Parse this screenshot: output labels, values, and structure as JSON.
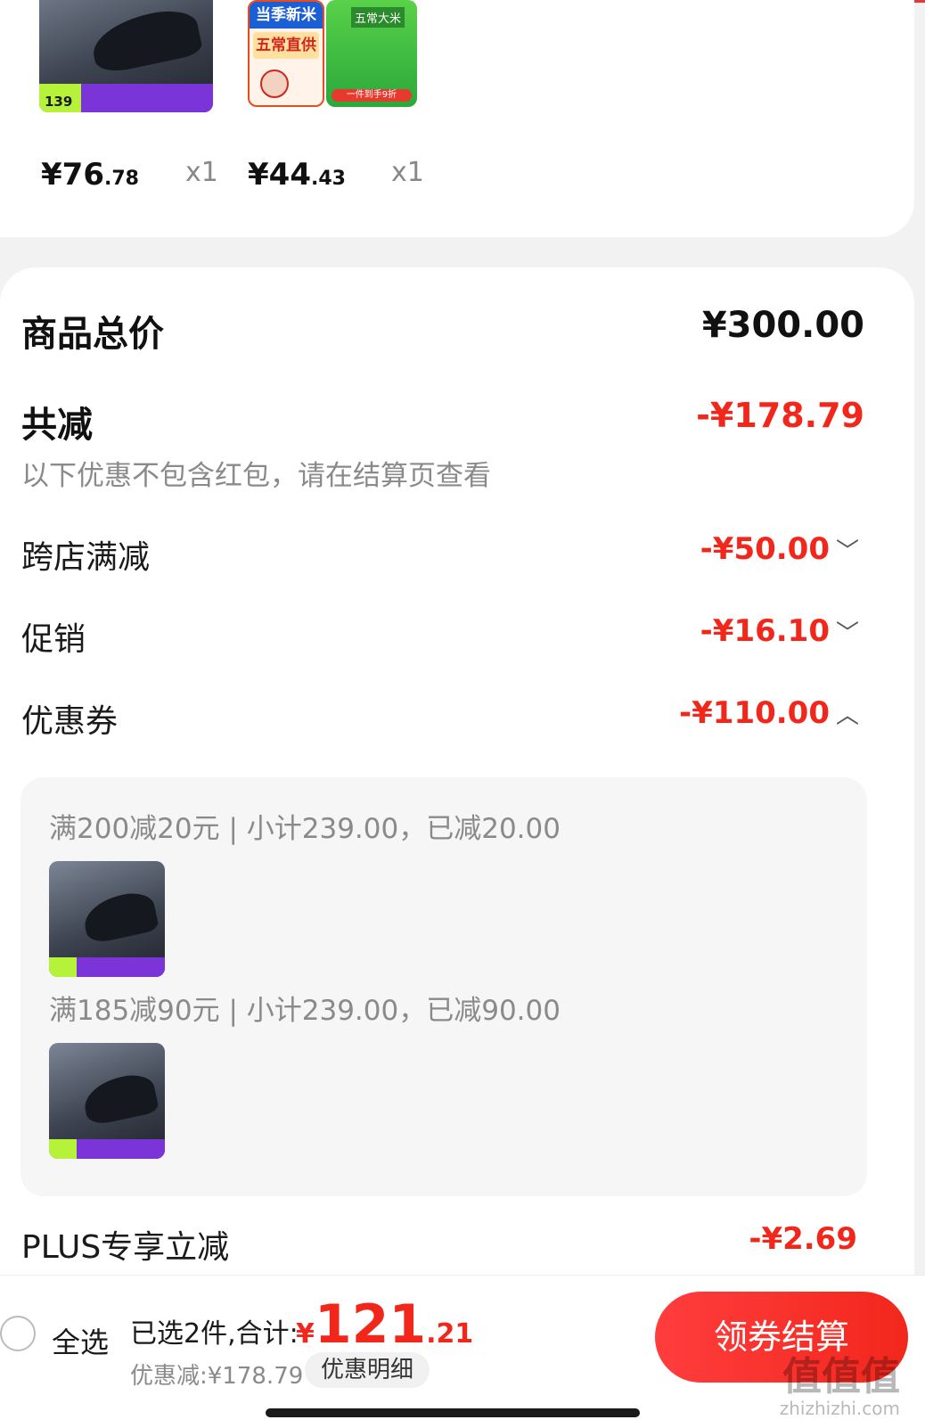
{
  "products": [
    {
      "name": "shoe",
      "price_int": "¥76",
      "price_dec": ".78",
      "qty": "x1"
    },
    {
      "name": "rice",
      "price_int": "¥44",
      "price_dec": ".43",
      "qty": "x1"
    }
  ],
  "rice_tags": {
    "season": "当季新米",
    "direct": "五常直供",
    "brand": "五常大米",
    "promo": "一件到手9折"
  },
  "shoe_tag": {
    "price": "139"
  },
  "summary": {
    "total_label": "商品总价",
    "total_value": "¥300.00",
    "reduce_label": "共减",
    "reduce_value": "-¥178.79",
    "note": "以下优惠不包含红包，请在结算页查看",
    "cross_store_label": "跨店满减",
    "cross_store_value": "-¥50.00",
    "promo_label": "促销",
    "promo_value": "-¥16.10",
    "coupon_label": "优惠券",
    "coupon_value": "-¥110.00",
    "plus_label": "PLUS专享立减",
    "plus_value": "-¥2.69"
  },
  "coupons": [
    {
      "text": "满200减20元 | 小计239.00，已减20.00"
    },
    {
      "text": "满185减90元 | 小计239.00，已减90.00"
    }
  ],
  "bottom": {
    "select_all": "全选",
    "selected_text": "已选2件,合计:",
    "currency": "¥",
    "total_int": "121",
    "total_dec": ".21",
    "discount_text": "优惠减:¥178.79",
    "detail_button": "优惠明细",
    "checkout_button": "领券结算",
    "watermark": "值值值",
    "watermark_sub": "zhizhizhi.com"
  },
  "colors": {
    "accent_red": "#f2271c",
    "checkout_red": "#f2271c"
  }
}
